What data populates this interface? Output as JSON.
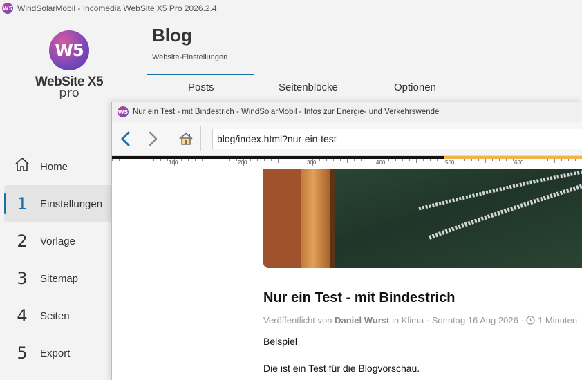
{
  "app": {
    "title": "WindSolarMobil - Incomedia WebSite X5 Pro 2026.2.4",
    "logo_text": "W5"
  },
  "brand": {
    "badge": "W5",
    "name": "WebSite X5",
    "sub": "pro"
  },
  "sidebar": {
    "items": [
      {
        "num": "",
        "label": "Home",
        "icon": "home-icon"
      },
      {
        "num": "1",
        "label": "Einstellungen"
      },
      {
        "num": "2",
        "label": "Vorlage"
      },
      {
        "num": "3",
        "label": "Sitemap"
      },
      {
        "num": "4",
        "label": "Seiten"
      },
      {
        "num": "5",
        "label": "Export"
      }
    ],
    "active_index": 1
  },
  "header": {
    "title": "Blog",
    "subtitle": "Website-Einstellungen",
    "tabs": [
      "Posts",
      "Seitenblöcke",
      "Optionen"
    ]
  },
  "preview": {
    "window_title": "Nur ein Test - mit Bindestrich - WindSolarMobil - Infos zur Energie- und Verkehrswende",
    "url": "blog/index.html?nur-ein-test",
    "ruler_labels": [
      "100",
      "200",
      "300",
      "400",
      "500",
      "600"
    ],
    "post": {
      "title": "Nur ein Test - mit Bindestrich",
      "meta_published": "Veröffentlicht von",
      "meta_author": "Daniel Wurst",
      "meta_in": "in Klima · Sonntag 16 Aug 2026 ·",
      "meta_read": "1 Minuten",
      "para1": "Beispiel",
      "para2": "Die ist ein Test für die Blogvorschau."
    }
  },
  "colors": {
    "accent": "#1a6fa8",
    "ruler_orange": "#f0b545"
  }
}
